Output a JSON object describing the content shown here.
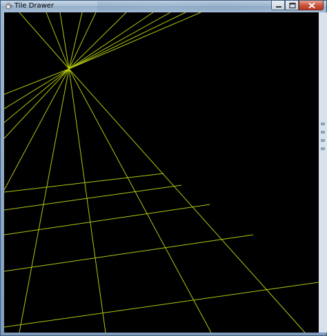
{
  "window": {
    "title": "Tile Drawer",
    "icon": "java-coffee-cup-icon"
  },
  "caption_buttons": {
    "minimize_icon": "minimize-icon",
    "maximize_icon": "maximize-icon",
    "close_icon": "close-icon"
  },
  "canvas": {
    "background": "#000000",
    "line_color": "#b4c810"
  }
}
